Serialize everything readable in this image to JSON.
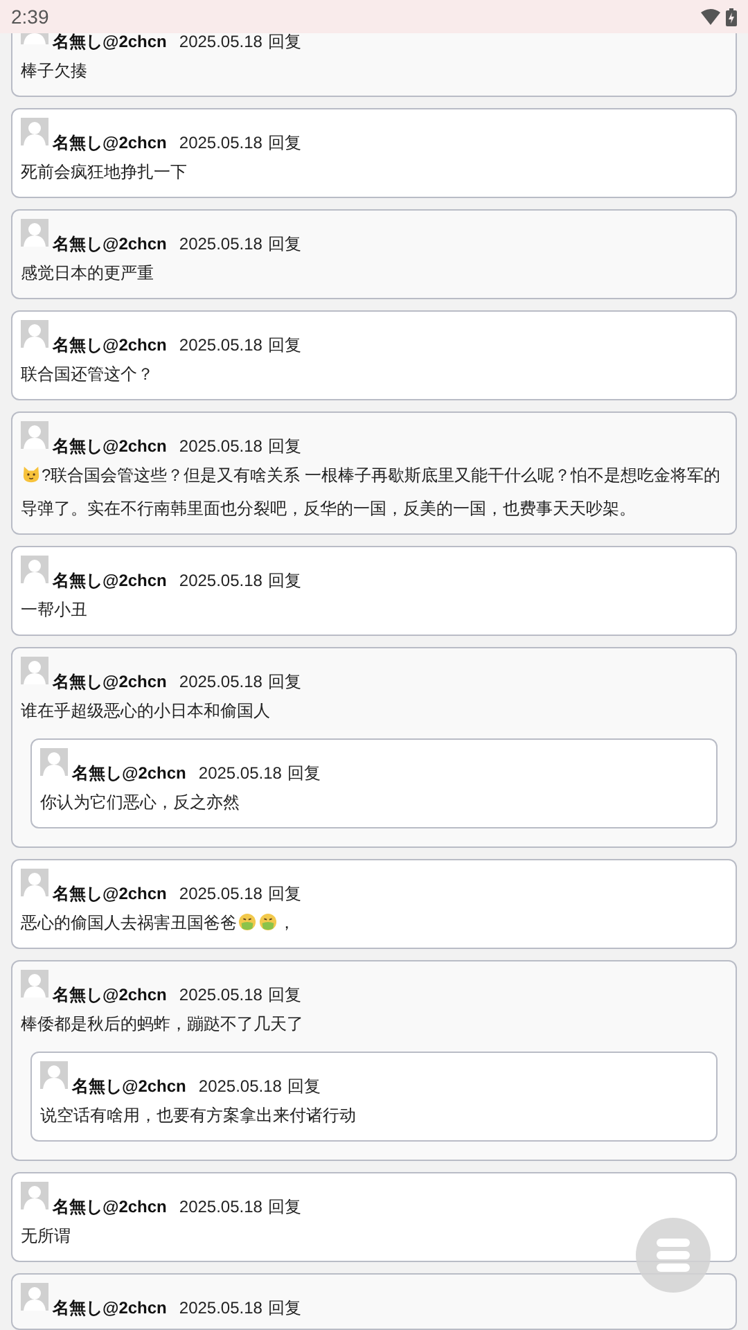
{
  "status_bar": {
    "time": "2:39"
  },
  "posts": [
    {
      "author": "名無し@2chcn",
      "date": "2025.05.18",
      "reply_label": "回复",
      "body": "棒子欠揍"
    },
    {
      "author": "名無し@2chcn",
      "date": "2025.05.18",
      "reply_label": "回复",
      "body": "死前会疯狂地挣扎一下"
    },
    {
      "author": "名無し@2chcn",
      "date": "2025.05.18",
      "reply_label": "回复",
      "body": "感觉日本的更严重"
    },
    {
      "author": "名無し@2chcn",
      "date": "2025.05.18",
      "reply_label": "回复",
      "body": "联合国还管这个？"
    },
    {
      "author": "名無し@2chcn",
      "date": "2025.05.18",
      "reply_label": "回复",
      "body_parts": [
        {
          "kind": "catface"
        },
        {
          "kind": "text",
          "text": "?联合国会管这些？但是又有啥关系 一根棒子再歇斯底里又能干什么呢？怕不是想吃金将军的导弹了。实在不行南韩里面也分裂吧，反华的一国，反美的一国，也费事天天吵架。"
        }
      ]
    },
    {
      "author": "名無し@2chcn",
      "date": "2025.05.18",
      "reply_label": "回复",
      "body": "一帮小丑"
    },
    {
      "author": "名無し@2chcn",
      "date": "2025.05.18",
      "reply_label": "回复",
      "body": "谁在乎超级恶心的小日本和偷国人",
      "replies": [
        {
          "author": "名無し@2chcn",
          "date": "2025.05.18",
          "reply_label": "回复",
          "body": "你认为它们恶心，反之亦然"
        }
      ]
    },
    {
      "author": "名無し@2chcn",
      "date": "2025.05.18",
      "reply_label": "回复",
      "body_parts": [
        {
          "kind": "text",
          "text": "恶心的偷国人去祸害丑国爸爸"
        },
        {
          "kind": "sickface"
        },
        {
          "kind": "sickface"
        },
        {
          "kind": "text",
          "text": "，"
        }
      ]
    },
    {
      "author": "名無し@2chcn",
      "date": "2025.05.18",
      "reply_label": "回复",
      "body": "棒倭都是秋后的蚂蚱，蹦跶不了几天了",
      "replies": [
        {
          "author": "名無し@2chcn",
          "date": "2025.05.18",
          "reply_label": "回复",
          "body": "说空话有啥用，也要有方案拿出来付诸行动"
        }
      ]
    },
    {
      "author": "名無し@2chcn",
      "date": "2025.05.18",
      "reply_label": "回复",
      "body": "无所谓"
    },
    {
      "author": "名無し@2chcn",
      "date": "2025.05.18",
      "reply_label": "回复"
    }
  ]
}
